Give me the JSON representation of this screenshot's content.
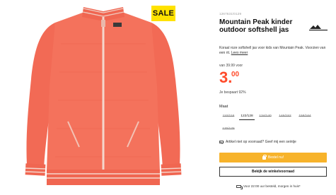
{
  "badge": {
    "sale": "SALE"
  },
  "product": {
    "sku": "1267631/0129",
    "title": "Mountain Peak kinder outdoor softshell jas",
    "description": "Koraal roze softshell jas voor kids van Mountain Peak. Voorzien van een rit.",
    "read_more": "Lees meer",
    "was_price": "van 39.99 voor",
    "price_int": "3.",
    "price_cents": "00",
    "saving": "Je bespaart 92%",
    "brand_logo_text": "MOUNTAIN PEAK"
  },
  "sizes": {
    "label": "Maat",
    "options": [
      {
        "label": "110/116",
        "available": false
      },
      {
        "label": "122/128",
        "available": true
      },
      {
        "label": "134/140",
        "available": false
      },
      {
        "label": "146/152",
        "available": false
      },
      {
        "label": "158/164",
        "available": false
      },
      {
        "label": "170/176",
        "available": false
      }
    ]
  },
  "stock_alert": "Artikel niet op voorraad? Geef mij een seintje",
  "buttons": {
    "add_to_cart": "Bestel nu!",
    "store_stock": "Bekijk de winkelvoorraad"
  },
  "delivery": "Voor 22:00 uur besteld, morgen in huis*",
  "colors": {
    "price": "#ff4b2b",
    "sale_badge": "#ffe200",
    "cart_button": "#f7b32b",
    "jacket": "#f26a55"
  },
  "icons": {
    "mail": "mail-icon",
    "bag": "shopping-bag-icon",
    "truck": "truck-icon"
  }
}
